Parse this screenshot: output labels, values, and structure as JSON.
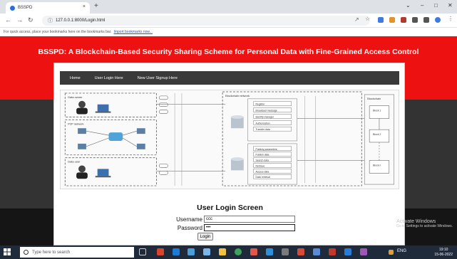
{
  "browser": {
    "tab_title": "BSSPD",
    "tab_close": "×",
    "new_tab": "+",
    "url": "127.0.0.1:8000/Login.html",
    "window_controls": [
      "⌄",
      "–",
      "□",
      "✕"
    ],
    "bookmarks_text": "For quick access, place your bookmarks here on the bookmarks bar.",
    "bookmarks_link": "Import bookmarks now..."
  },
  "page": {
    "heading": "BSSPD: A Blockchain-Based Security Sharing Scheme for Personal Data with Fine-Grained Access Control",
    "menu": [
      "Home",
      "User Login Here",
      "New User Signup Here"
    ],
    "login": {
      "title": "User Login Screen",
      "username_label": "Username",
      "username_value": "ccc",
      "password_label": "Password",
      "password_value": "ccc",
      "button": "Login"
    },
    "activate": {
      "line1": "Activate Windows",
      "line2": "Go to Settings to activate Windows."
    },
    "colors": {
      "header_red": "#ee1111",
      "dark_band": "#333333",
      "menubar": "#3a3a3a"
    }
  },
  "diagram": {
    "labels": [
      "Data owner",
      "P2P network",
      "Data user",
      "Blockchain network",
      "Blockchain",
      "Block 1",
      "Block 2",
      "Block n"
    ],
    "stack_upper": [
      "Register",
      "Broadcast message",
      "Identify manager",
      "Authorization",
      "Transfer data"
    ],
    "stack_lower": [
      "Publicly parameters",
      "Publish data",
      "Search data",
      "Retrieve",
      "Access data",
      "Data retrieval"
    ],
    "icons": [
      "user-icon",
      "server-icon",
      "laptop-icon",
      "database-icon"
    ]
  },
  "taskbar": {
    "search_placeholder": "Type here to search",
    "time": "19:10",
    "date": "15-06-2022",
    "lang": "ENG"
  }
}
